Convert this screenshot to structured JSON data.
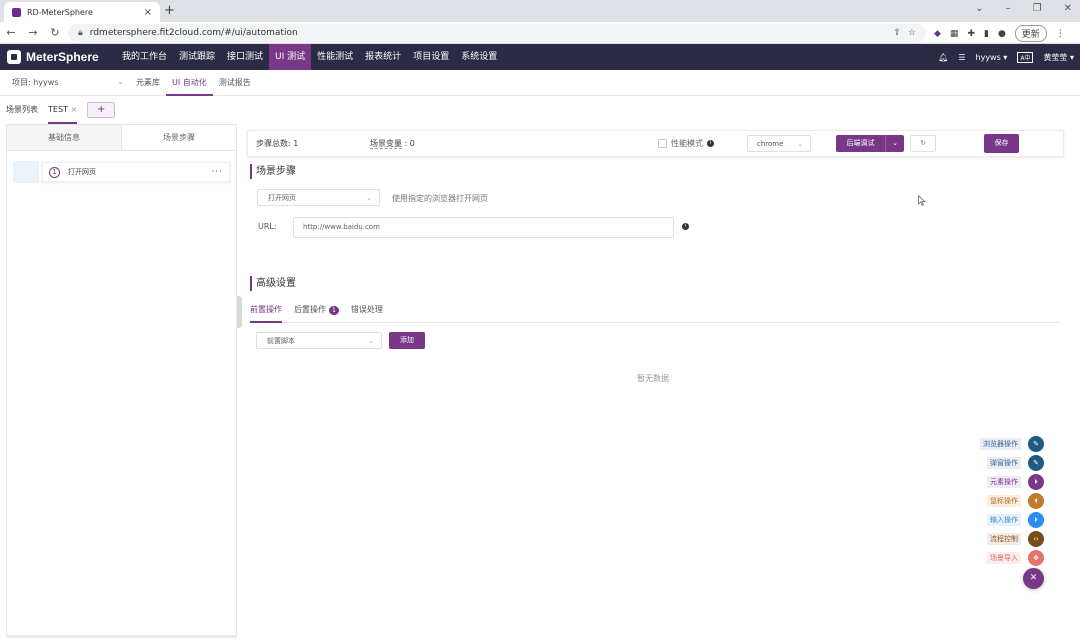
{
  "browser": {
    "tab_title": "RD-MeterSphere",
    "url": "rdmetersphere.fit2cloud.com/#/ui/automation",
    "update_label": "更新"
  },
  "app": {
    "brand": "MeterSphere",
    "nav": [
      {
        "label": "我的工作台",
        "active": false
      },
      {
        "label": "测试跟踪",
        "active": false
      },
      {
        "label": "接口测试",
        "active": false
      },
      {
        "label": "UI 测试",
        "active": true
      },
      {
        "label": "性能测试",
        "active": false
      },
      {
        "label": "报表统计",
        "active": false
      },
      {
        "label": "项目设置",
        "active": false
      },
      {
        "label": "系统设置",
        "active": false
      }
    ],
    "workspace": "hyyws",
    "user": "黄莹莹"
  },
  "subnav": {
    "project": "项目: hyyws",
    "links": [
      {
        "label": "元素库",
        "active": false
      },
      {
        "label": "UI 自动化",
        "active": true
      },
      {
        "label": "测试报告",
        "active": false
      }
    ]
  },
  "scene_tabs": {
    "list_label": "场景列表",
    "current": "TEST",
    "add_label": "+"
  },
  "left_panel": {
    "tab_basic": "基础信息",
    "tab_steps": "场景步骤",
    "step": {
      "number": "1",
      "name": "打开网页",
      "more": "···"
    }
  },
  "toolbar": {
    "step_count": "步骤总数: 1",
    "var_label": "场景变量",
    "var_value": ": 0",
    "perf_mode": "性能模式",
    "browser": "chrome",
    "debug": "后端调试",
    "save": "保存"
  },
  "main": {
    "section_steps": "场景步骤",
    "step_type": "打开网页",
    "step_desc": "使用指定的浏览器打开网页",
    "url_label": "URL:",
    "url_value": "http://www.baidu.com",
    "section_advanced": "高级设置",
    "adv_tabs": [
      {
        "label": "前置操作",
        "active": true,
        "badge": ""
      },
      {
        "label": "后置操作",
        "active": false,
        "badge": "1"
      },
      {
        "label": "错误处理",
        "active": false,
        "badge": ""
      }
    ],
    "script_select": "前置脚本",
    "add_label": "添加",
    "empty_text": "暂无数据"
  },
  "fab": [
    {
      "label": "浏览器操作",
      "label_bg": "#e8eef6",
      "label_color": "#40618a",
      "color": "#1d5a84"
    },
    {
      "label": "弹窗操作",
      "label_bg": "#e8eef6",
      "label_color": "#40618a",
      "color": "#1d5a84"
    },
    {
      "label": "元素操作",
      "label_bg": "#f2e9f5",
      "label_color": "#783887",
      "color": "#783887"
    },
    {
      "label": "鼠标操作",
      "label_bg": "#fbeedf",
      "label_color": "#b06b23",
      "color": "#c07a2c"
    },
    {
      "label": "输入操作",
      "label_bg": "#e6f2fc",
      "label_color": "#3b86d1",
      "color": "#2d8cf0"
    },
    {
      "label": "流程控制",
      "label_bg": "#f4ebe2",
      "label_color": "#8a5a2b",
      "color": "#7b4a1a"
    },
    {
      "label": "场景导入",
      "label_bg": "#fdeceb",
      "label_color": "#d46a64",
      "color": "#e6726c"
    }
  ],
  "fab_close": "✕"
}
